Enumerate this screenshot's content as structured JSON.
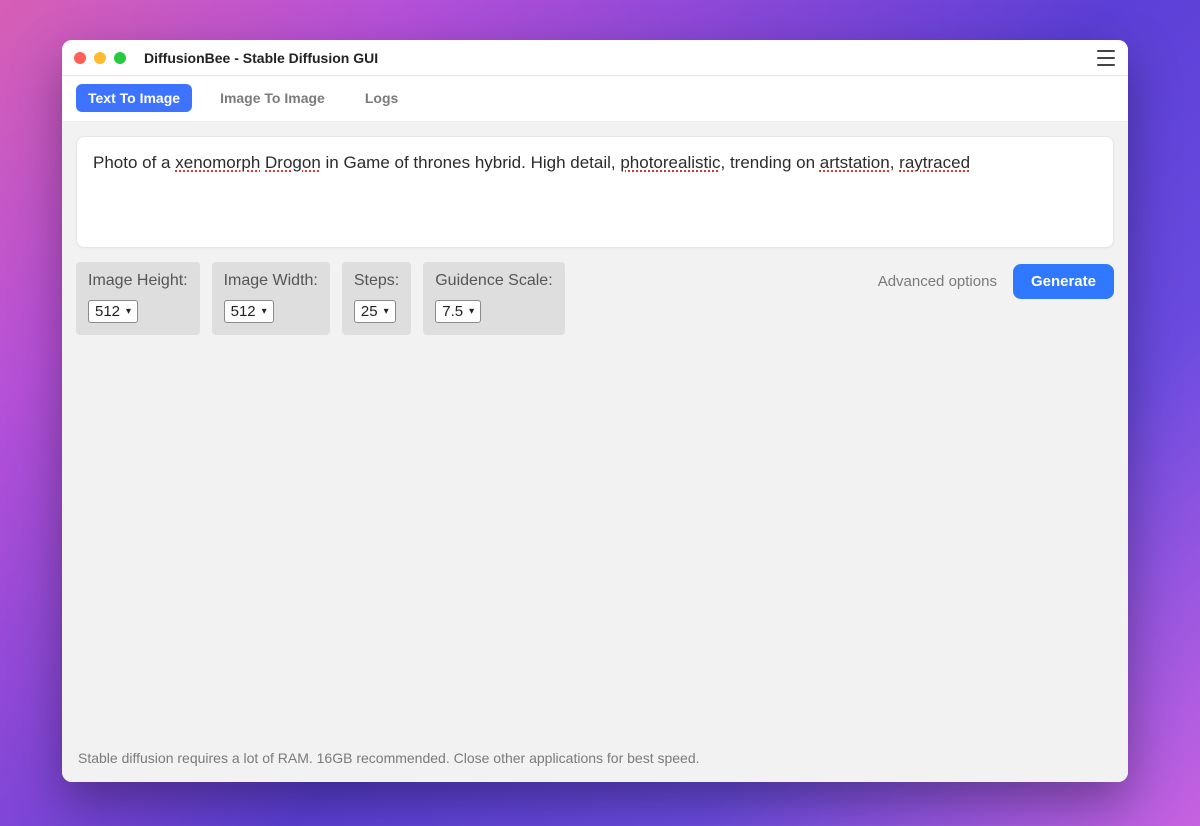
{
  "window": {
    "title": "DiffusionBee - Stable Diffusion GUI"
  },
  "tabs": {
    "text_to_image": "Text To Image",
    "image_to_image": "Image To Image",
    "logs": "Logs",
    "active": "text_to_image"
  },
  "prompt": {
    "plain_prefix": "Photo of a ",
    "spell1": "xenomorph",
    "space1": " ",
    "spell2": "Drogon",
    "mid1": " in Game of thrones hybrid. High detail, ",
    "spell3": "photorealistic",
    "mid2": ", trending on ",
    "spell4": "artstation",
    "mid3": ", ",
    "spell5": "raytraced",
    "full_text": "Photo of a xenomorph Drogon in Game of thrones hybrid. High detail, photorealistic, trending on artstation, raytraced"
  },
  "params": {
    "image_height": {
      "label": "Image Height:",
      "value": "512"
    },
    "image_width": {
      "label": "Image Width:",
      "value": "512"
    },
    "steps": {
      "label": "Steps:",
      "value": "25"
    },
    "guidance": {
      "label": "Guidence Scale:",
      "value": "7.5"
    }
  },
  "actions": {
    "advanced_options": "Advanced options",
    "generate": "Generate"
  },
  "footer": {
    "note": "Stable diffusion requires a lot of RAM. 16GB recommended. Close other applications for best speed."
  }
}
